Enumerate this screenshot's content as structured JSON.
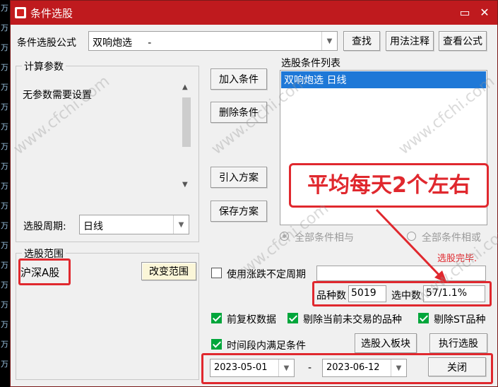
{
  "window": {
    "title": "条件选股"
  },
  "formula": {
    "label": "条件选股公式",
    "value": "双响炮选     -",
    "find_btn": "查找",
    "usage_btn": "用法注释",
    "view_btn": "查看公式"
  },
  "params": {
    "title": "计算参数",
    "text": "无参数需要设置",
    "period_label": "选股周期:",
    "period_value": "日线"
  },
  "range": {
    "title": "选股范围",
    "value": "沪深A股",
    "change_btn": "改变范围"
  },
  "actions": {
    "add": "加入条件",
    "delete": "删除条件",
    "import": "引入方案",
    "save": "保存方案"
  },
  "conditions": {
    "title": "选股条件列表",
    "items": [
      "双响炮选  日线"
    ],
    "logic_and": "全部条件相与",
    "logic_or": "全部条件相或",
    "status": "选股完毕."
  },
  "options": {
    "use_unfixed_period": "使用涨跌不定周期",
    "count_label": "品种数",
    "count_value": "5019",
    "selected_label": "选中数",
    "selected_value": "57/1.1%",
    "forward_adjust": "前复权数据",
    "exclude_untraded": "剔除当前未交易的品种",
    "exclude_st": "剔除ST品种",
    "time_range": "时间段内满足条件",
    "to_block_btn": "选股入板块",
    "run_btn": "执行选股"
  },
  "dates": {
    "start": "2023-05-01",
    "separator": "-",
    "end": "2023-06-12",
    "close_btn": "关闭"
  },
  "annotation": {
    "callout": "平均每天2个左右"
  },
  "watermark": "www.cfchi.com",
  "colors": {
    "title_bar": "#bf1a1e",
    "highlight": "#e0282e",
    "selection": "#1e78d7",
    "check": "#00a63b"
  }
}
